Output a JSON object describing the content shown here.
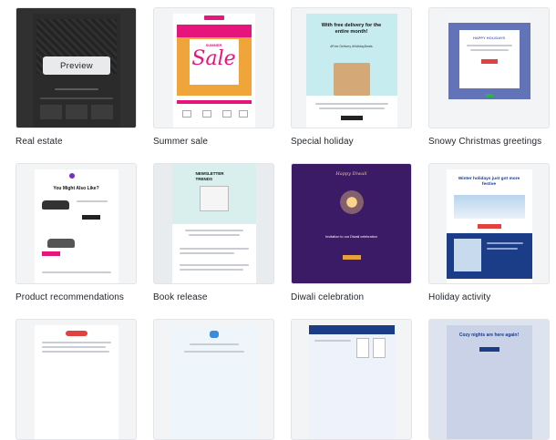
{
  "templates": [
    {
      "label": "Real estate",
      "preview_label": "Preview"
    },
    {
      "label": "Summer sale",
      "sale_small": "SUMMER",
      "sale_big": "Sale"
    },
    {
      "label": "Special holiday",
      "headline": "With free delivery for the entire month!",
      "tags": "#Free Delivery #HolidayDeals"
    },
    {
      "label": "Snowy Christmas greetings",
      "headline": "HAPPY HOLIDAYS"
    },
    {
      "label": "Product recommendations",
      "headline": "You Might Also Like?"
    },
    {
      "label": "Book release",
      "headline": "NEWSLETTER TRENDS"
    },
    {
      "label": "Diwali celebration",
      "headline": "Happy Diwali",
      "subline": "Invitation to our Diwali celebration"
    },
    {
      "label": "Holiday activity",
      "headline": "Winter holidays just got more festive"
    },
    {
      "label": ""
    },
    {
      "label": ""
    },
    {
      "label": ""
    },
    {
      "label": "",
      "headline": "Cozy nights are here again!"
    }
  ],
  "colors": {
    "accent_pink": "#e6157b",
    "diwali_purple": "#3b1b66",
    "holiday_blue": "#1b3c86",
    "snow_blue": "#6273b8"
  }
}
